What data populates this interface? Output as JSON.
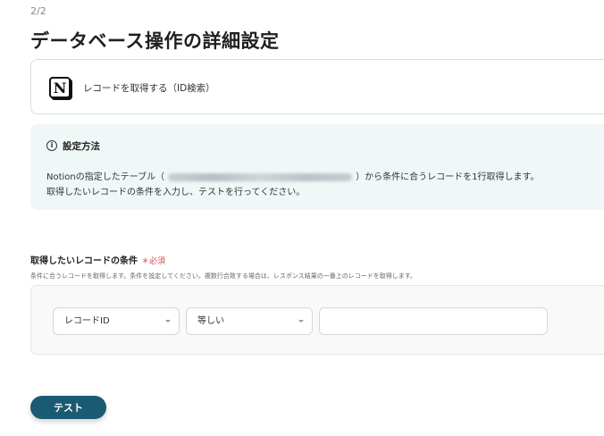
{
  "header": {
    "step": "2/2",
    "title": "データベース操作の詳細設定"
  },
  "action": {
    "icon": "notion-logo",
    "logo_letter": "N",
    "label": "レコードを取得する（ID検索）"
  },
  "info": {
    "icon": "info-icon",
    "icon_glyph": "i",
    "title": "設定方法",
    "line1_prefix": "Notionの指定したテーブル（",
    "line1_suffix": "）から条件に合うレコードを1行取得します。",
    "line2": "取得したいレコードの条件を入力し、テストを行ってください。"
  },
  "conditions": {
    "title": "取得したいレコードの条件",
    "required_label": "＊必須",
    "description": "条件に合うレコードを取得します。条件を設定してください。複数行合致する場合は、レスポンス結果の一番上のレコードを取得します。",
    "field_select": "レコードID",
    "operator_select": "等しい",
    "value_input": "",
    "value_placeholder": ""
  },
  "actions": {
    "test_label": "テスト"
  },
  "colors": {
    "primary": "#1a5a72",
    "info_bg": "#f0f7f7",
    "required": "#e0464e"
  }
}
